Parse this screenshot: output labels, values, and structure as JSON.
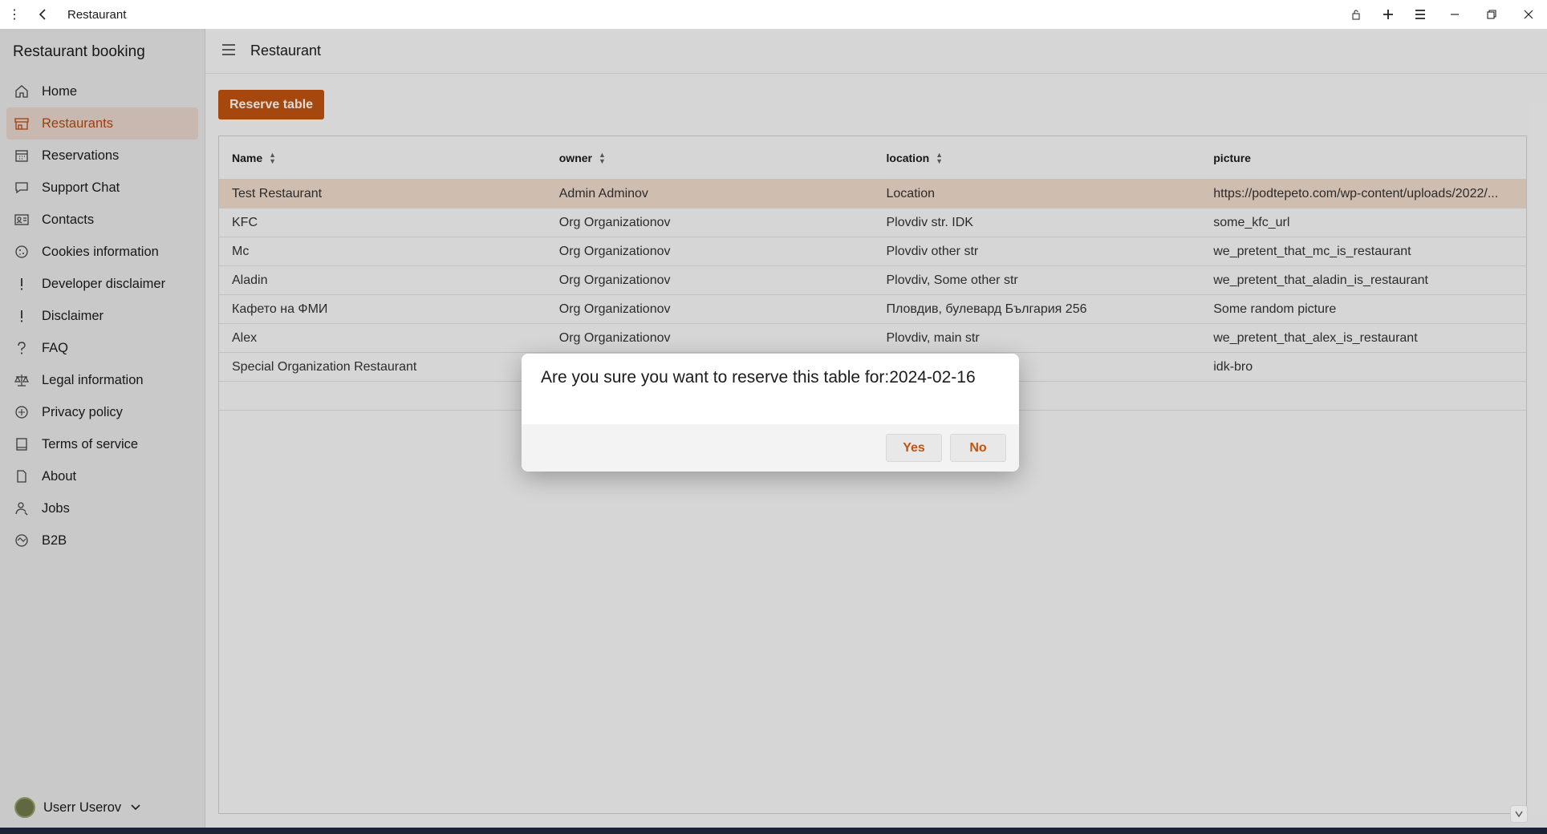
{
  "window": {
    "title": "Restaurant"
  },
  "sidebar": {
    "app_title": "Restaurant booking",
    "items": [
      {
        "label": "Home",
        "icon": "home-icon"
      },
      {
        "label": "Restaurants",
        "icon": "store-icon",
        "active": true
      },
      {
        "label": "Reservations",
        "icon": "calendar-icon"
      },
      {
        "label": "Support Chat",
        "icon": "chat-icon"
      },
      {
        "label": "Contacts",
        "icon": "contact-card-icon"
      },
      {
        "label": "Cookies information",
        "icon": "cookie-icon"
      },
      {
        "label": "Developer disclaimer",
        "icon": "exclamation-icon"
      },
      {
        "label": "Disclaimer",
        "icon": "exclamation-icon"
      },
      {
        "label": "FAQ",
        "icon": "question-icon"
      },
      {
        "label": "Legal information",
        "icon": "scales-icon"
      },
      {
        "label": "Privacy policy",
        "icon": "privacy-icon"
      },
      {
        "label": "Terms of service",
        "icon": "document-icon"
      },
      {
        "label": "About",
        "icon": "page-icon"
      },
      {
        "label": "Jobs",
        "icon": "person-icon"
      },
      {
        "label": "B2B",
        "icon": "handshake-icon"
      }
    ],
    "user": {
      "name": "Userr Userov"
    }
  },
  "main": {
    "title": "Restaurant",
    "reserve_button": "Reserve table",
    "columns": [
      "Name",
      "owner",
      "location",
      "picture"
    ],
    "rows": [
      [
        "Test Restaurant",
        "Admin Adminov",
        "Location",
        "https://podtepeto.com/wp-content/uploads/2022/..."
      ],
      [
        "KFC",
        "Org Organizationov",
        "Plovdiv str. IDK",
        "some_kfc_url"
      ],
      [
        "Mc",
        "Org Organizationov",
        "Plovdiv other str",
        "we_pretent_that_mc_is_restaurant"
      ],
      [
        "Aladin",
        "Org Organizationov",
        "Plovdiv, Some other str",
        "we_pretent_that_aladin_is_restaurant"
      ],
      [
        "Кафето на ФМИ",
        "Org Organizationov",
        "Пловдив, булевард България 256",
        "Some random picture"
      ],
      [
        "Alex",
        "Org Organizationov",
        "Plovdiv, main str",
        "we_pretent_that_alex_is_restaurant"
      ],
      [
        "Special Organization Restaurant",
        "",
        "",
        "idk-bro"
      ]
    ]
  },
  "dialog": {
    "message": "Are you sure you want to reserve this table for:2024-02-16",
    "yes": "Yes",
    "no": "No"
  },
  "colors": {
    "accent": "#c25410",
    "selected_row": "#f2dccd",
    "active_nav": "#ead7cc"
  }
}
